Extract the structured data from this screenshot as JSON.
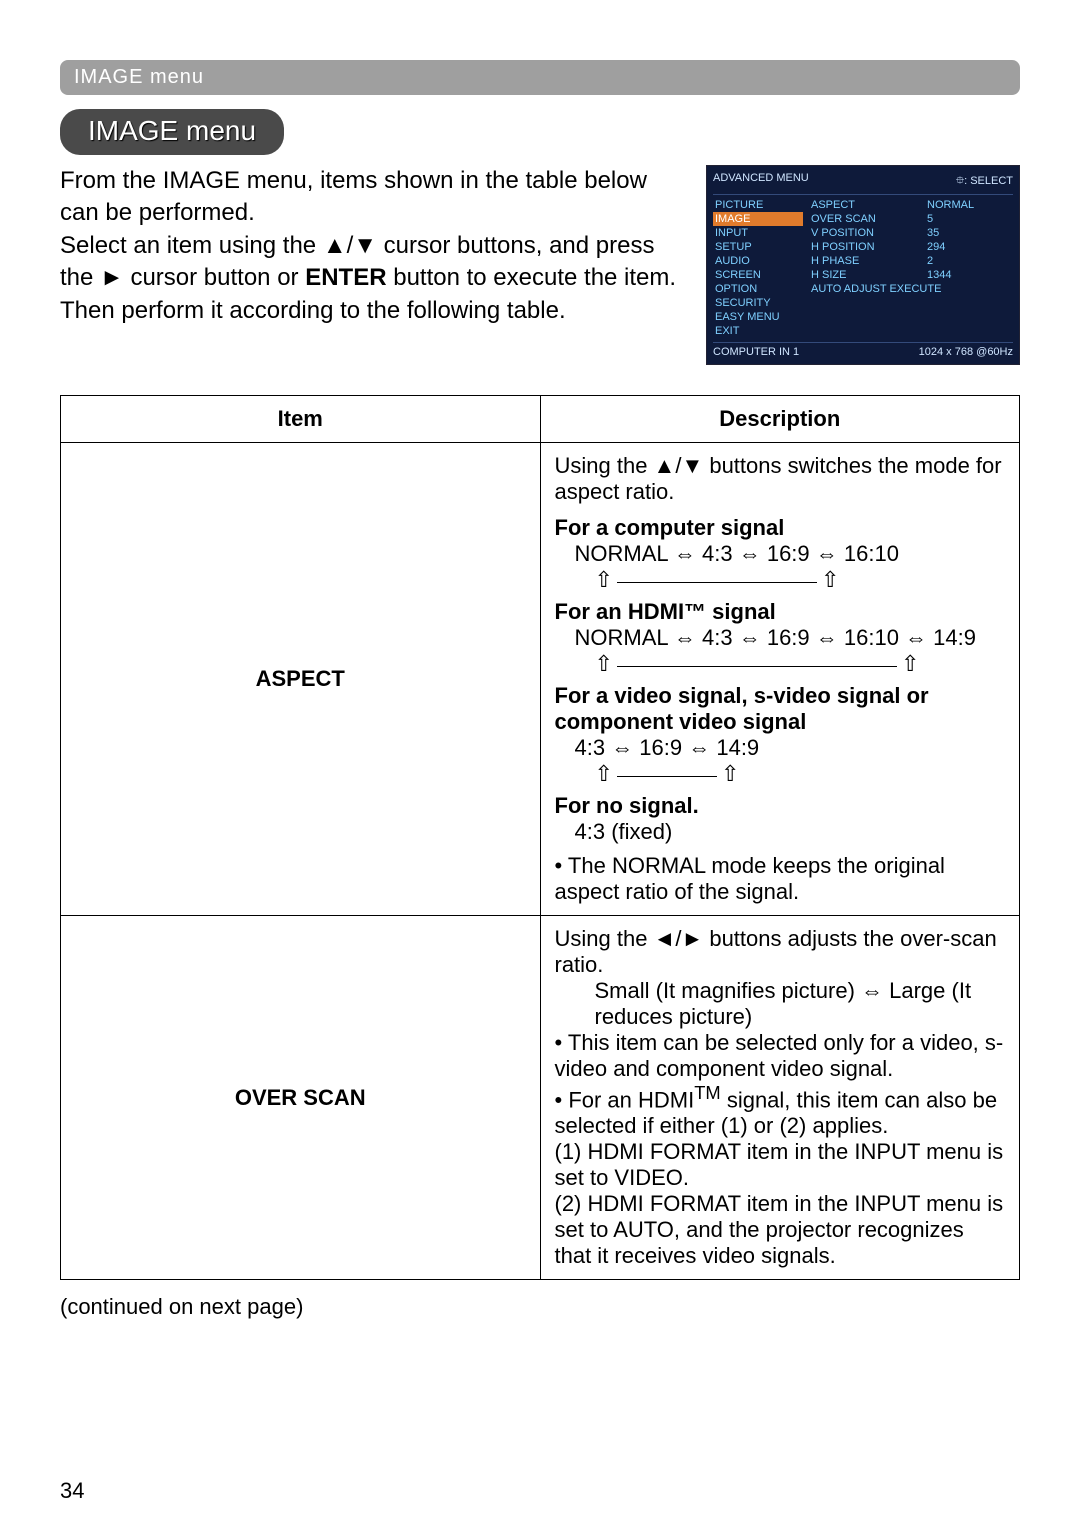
{
  "header_bar": "IMAGE menu",
  "pill_title": "IMAGE menu",
  "intro": {
    "p1": "From the IMAGE menu, items shown in the table below can be performed.",
    "p2_a": "Select an item using the ▲/▼ cursor buttons, and press the ► cursor button or ",
    "p2_enter": "ENTER",
    "p2_b": " button to execute the item. Then perform it according to the following table."
  },
  "osd": {
    "top_left": "ADVANCED MENU",
    "top_right": "⯐: SELECT",
    "left_items": [
      "PICTURE",
      "IMAGE",
      "INPUT",
      "SETUP",
      "AUDIO",
      "SCREEN",
      "OPTION",
      "SECURITY",
      "EASY MENU",
      "EXIT"
    ],
    "mid_items": [
      "ASPECT",
      "OVER SCAN",
      "V POSITION",
      "H POSITION",
      "H PHASE",
      "H SIZE",
      "AUTO ADJUST EXECUTE"
    ],
    "right_items": [
      "NORMAL",
      "5",
      "35",
      "294",
      "2",
      "1344",
      ""
    ],
    "bottom_left": "COMPUTER IN 1",
    "bottom_right": "1024 x 768 @60Hz"
  },
  "table": {
    "head_item": "Item",
    "head_desc": "Description",
    "aspect": {
      "label": "ASPECT",
      "line1": "Using the ▲/▼ buttons switches the mode for aspect ratio.",
      "c_head": "For a computer signal",
      "c_line": "NORMAL ⇔ 4:3 ⇔ 16:9 ⇔ 16:10",
      "h_head": "For an HDMI™ signal",
      "h_line": "NORMAL ⇔ 4:3 ⇔ 16:9 ⇔ 16:10 ⇔ 14:9",
      "v_head": "For a video signal, s-video signal or component video signal",
      "v_line": "4:3 ⇔ 16:9 ⇔ 14:9",
      "n_head": "For no signal.",
      "n_line": "4:3 (fixed)",
      "note": "• The NORMAL mode keeps the original aspect ratio of the signal."
    },
    "overscan": {
      "label": "OVER SCAN",
      "l1": "Using the ◄/► buttons adjusts the over-scan ratio.",
      "l2": "Small (It magnifies picture) ⇔ Large (It reduces picture)",
      "l3": "• This item can be selected only for a video, s-video and component video signal.",
      "l4a": "• For an HDMI",
      "l4tm": "TM",
      "l4b": " signal, this item can also be selected if either (1) or (2) applies.",
      "l5": "(1) HDMI FORMAT item in the INPUT menu is set to VIDEO.",
      "l6": "(2) HDMI FORMAT item in the INPUT menu is set to AUTO, and the projector recognizes that it receives video signals."
    }
  },
  "continued": "(continued on next page)",
  "page_num": "34"
}
